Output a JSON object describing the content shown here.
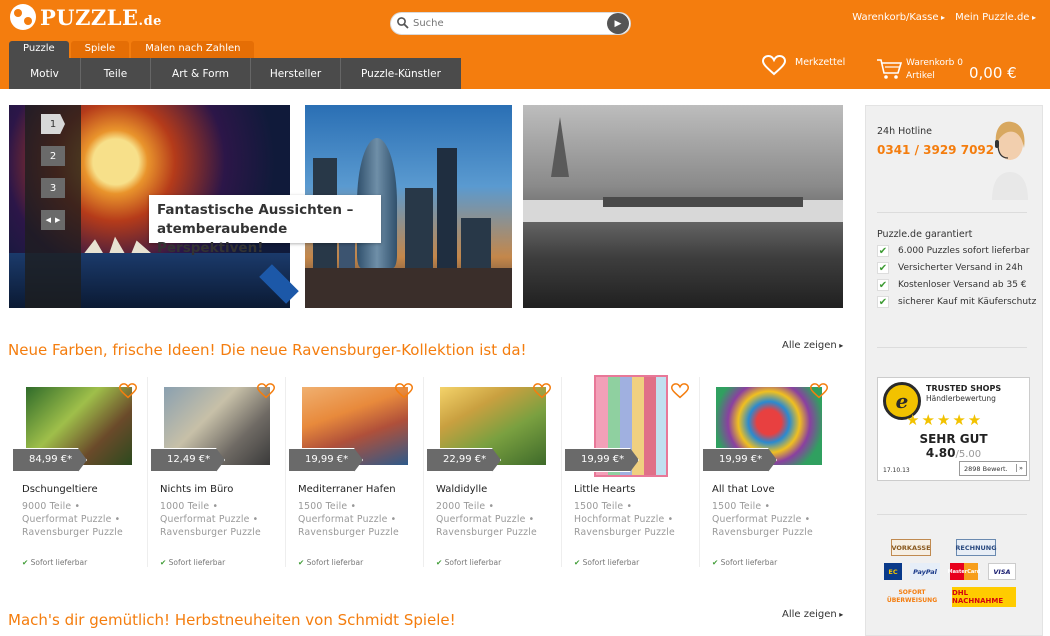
{
  "header": {
    "logo_text": "PUZZLE",
    "logo_suffix": ".de",
    "search_placeholder": "Suche",
    "top_links": [
      "Warenkorb/Kasse",
      "Mein Puzzle.de"
    ],
    "tabs": [
      "Puzzle",
      "Spiele",
      "Malen nach Zahlen"
    ],
    "categories": [
      "Motiv",
      "Teile",
      "Art & Form",
      "Hersteller",
      "Puzzle-Künstler"
    ],
    "wishlist_label": "Merkzettel",
    "cart_label": "Warenkorb 0",
    "cart_items_label": "Artikel",
    "cart_total": "0,00 €",
    "brand_color": "#f47d0e"
  },
  "hero": {
    "slide_numbers": [
      "1",
      "2",
      "3"
    ],
    "caption_line1": "Fantastische Aussichten –",
    "caption_line2": "atemberaubende Perspektiven!"
  },
  "sections": [
    {
      "title": "Neue Farben, frische Ideen! Die neue Ravensburger-Kollektion ist da!",
      "link": "Alle zeigen"
    },
    {
      "title": "Mach's dir gemütlich! Herbstneuheiten von Schmidt Spiele!",
      "link": "Alle zeigen"
    }
  ],
  "products": [
    {
      "price": "84,99 €*",
      "name": "Dschungeltiere",
      "pieces": "9000 Teile •",
      "format": "Querformat Puzzle •",
      "brand": "Ravensburger Puzzle",
      "stock": "Sofort lieferbar"
    },
    {
      "price": "12,49 €*",
      "name": "Nichts im Büro",
      "pieces": "1000 Teile •",
      "format": "Querformat Puzzle •",
      "brand": "Ravensburger Puzzle",
      "stock": "Sofort lieferbar"
    },
    {
      "price": "19,99 €*",
      "name": "Mediterraner Hafen",
      "pieces": "1500 Teile •",
      "format": "Querformat Puzzle •",
      "brand": "Ravensburger Puzzle",
      "stock": "Sofort lieferbar"
    },
    {
      "price": "22,99 €*",
      "name": "Waldidylle",
      "pieces": "2000 Teile •",
      "format": "Querformat Puzzle •",
      "brand": "Ravensburger Puzzle",
      "stock": "Sofort lieferbar"
    },
    {
      "price": "19,99 €*",
      "name": "Little Hearts",
      "pieces": "1500 Teile •",
      "format": "Hochformat Puzzle •",
      "brand": "Ravensburger Puzzle",
      "stock": "Sofort lieferbar"
    },
    {
      "price": "19,99 €*",
      "name": "All that Love",
      "pieces": "1500 Teile •",
      "format": "Querformat Puzzle •",
      "brand": "Ravensburger Puzzle",
      "stock": "Sofort lieferbar"
    }
  ],
  "sidebar": {
    "hotline_label": "24h Hotline",
    "hotline_number": "0341 / 3929 7092",
    "guarantee_title": "Puzzle.de garantiert",
    "guarantees": [
      "6.000 Puzzles sofort lieferbar",
      "Versicherter Versand in 24h",
      "Kostenloser Versand ab 35 €",
      "sicherer Kauf mit Käuferschutz"
    ],
    "trusted": {
      "name": "TRUSTED SHOPS",
      "sub": "Händlerbewertung",
      "stars": "★★★★★",
      "grade": "SEHR GUT",
      "score": "4.80",
      "score_max": "/5.00",
      "date": "17.10.13",
      "reviews": "2898 Bewert."
    },
    "payments": [
      "VORKASSE",
      "RECHNUNG",
      "EC",
      "PayPal",
      "MasterCard",
      "VISA",
      "SOFORT ÜBERWEISUNG",
      "DHL NACHNAHME"
    ]
  }
}
